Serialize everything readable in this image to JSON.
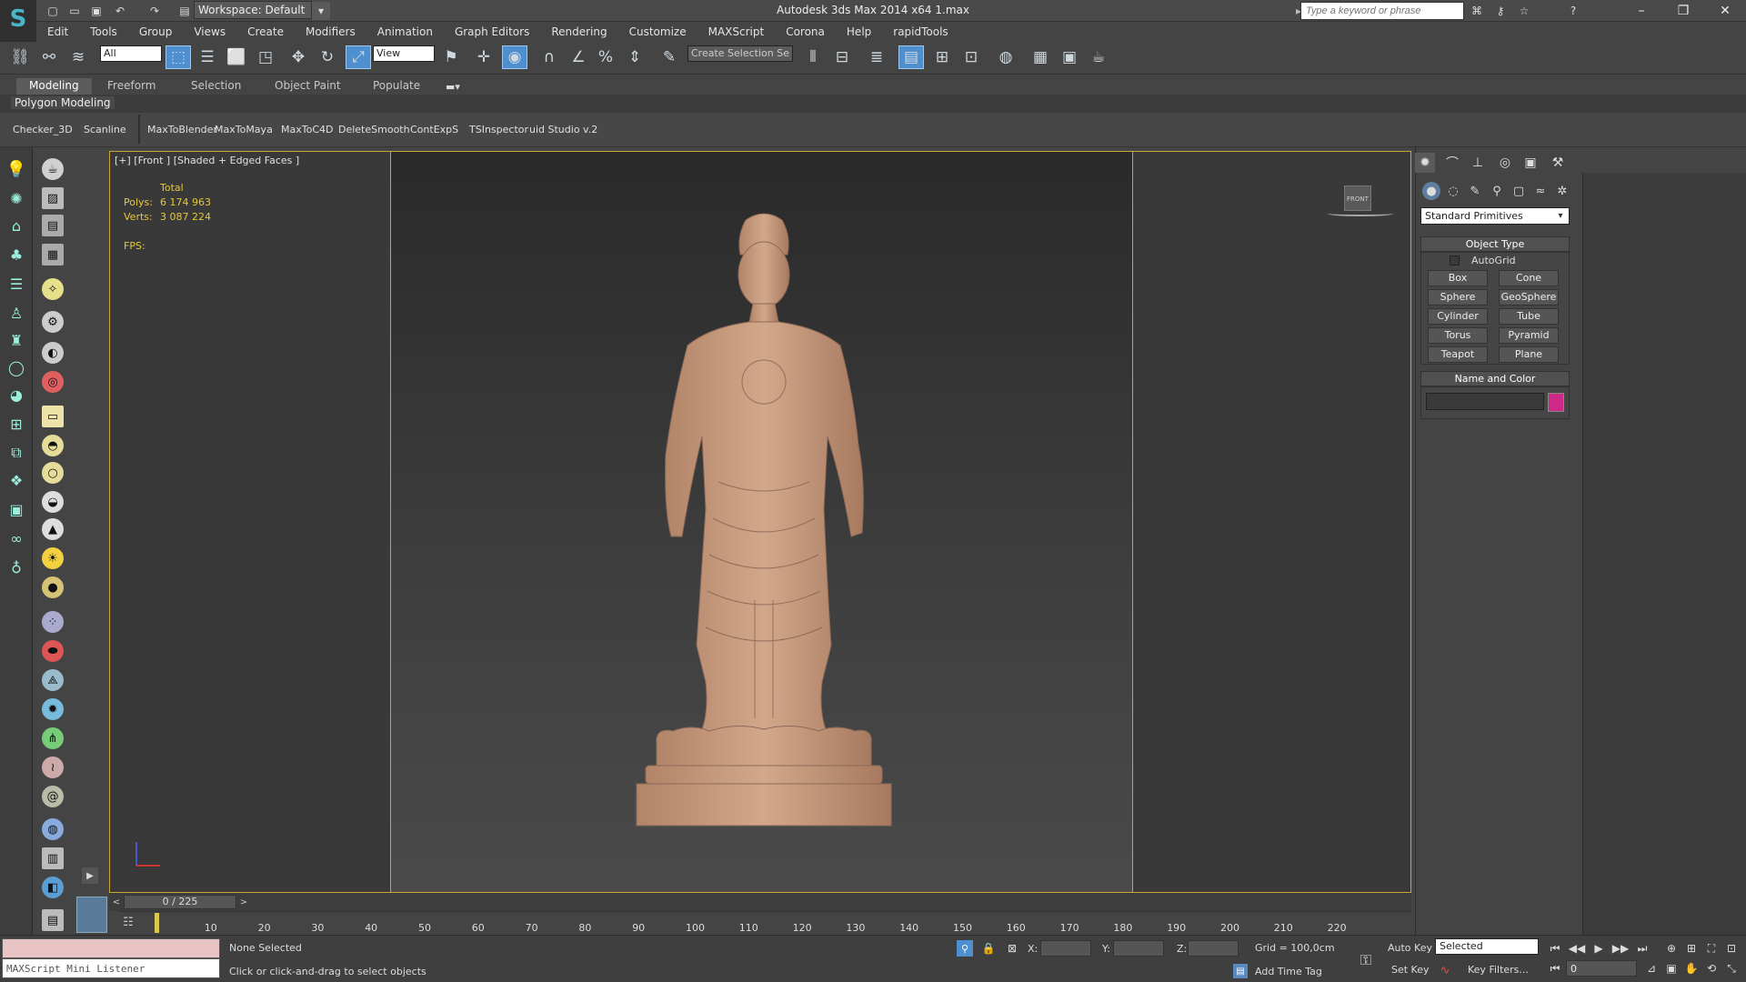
{
  "window": {
    "title": "Autodesk 3ds Max  2014 x64     1.max",
    "workspace": "Workspace: Default",
    "search_placeholder": "Type a keyword or phrase"
  },
  "menu": [
    "Edit",
    "Tools",
    "Group",
    "Views",
    "Create",
    "Modifiers",
    "Animation",
    "Graph Editors",
    "Rendering",
    "Customize",
    "MAXScript",
    "Corona",
    "Help",
    "rapidTools"
  ],
  "toolbar": {
    "filter": "All",
    "ref_coord": "View",
    "named_selection": "Create Selection Se"
  },
  "ribbon": {
    "tabs": [
      "Modeling",
      "Freeform",
      "Selection",
      "Object Paint",
      "Populate"
    ],
    "active": "Modeling",
    "panel": "Polygon Modeling"
  },
  "scripts": [
    "Checker_3D",
    "Scanline",
    "MaxToBlender",
    "MaxToMaya",
    "MaxToC4D",
    "DeleteSmooth",
    "ContExpS",
    "TSInspector",
    "uid Studio v.2"
  ],
  "viewport": {
    "label": "[+] [Front ] [Shaded + Edged Faces ]",
    "stats_header": "Total",
    "polys_label": "Polys:",
    "polys": "6 174 963",
    "verts_label": "Verts:",
    "verts": "3 087 224",
    "fps_label": "FPS:",
    "viewcube": "FRONT"
  },
  "command_panel": {
    "primitive_type": "Standard Primitives",
    "object_type_title": "Object Type",
    "autogrid": "AutoGrid",
    "buttons": [
      "Box",
      "Cone",
      "Sphere",
      "GeoSphere",
      "Cylinder",
      "Tube",
      "Torus",
      "Pyramid",
      "Teapot",
      "Plane"
    ],
    "name_color_title": "Name and Color",
    "object_color": "#cc2a86"
  },
  "timeline": {
    "frame_display": "0 / 225",
    "ticks": [
      "10",
      "20",
      "30",
      "40",
      "50",
      "60",
      "70",
      "80",
      "90",
      "100",
      "110",
      "120",
      "130",
      "140",
      "150",
      "160",
      "170",
      "180",
      "190",
      "200",
      "210",
      "220"
    ]
  },
  "status": {
    "listener": "MAXScript Mini Listener",
    "selection": "None Selected",
    "prompt": "Click or click-and-drag to select objects",
    "x_label": "X:",
    "y_label": "Y:",
    "z_label": "Z:",
    "grid": "Grid = 100,0cm",
    "add_time_tag": "Add Time Tag",
    "auto_key": "Auto Key",
    "set_key": "Set Key",
    "selected": "Selected",
    "key_filters": "Key Filters...",
    "frame": "0"
  },
  "colors": {
    "viewport_frame": "#c8a830",
    "stats": "#e6c83a",
    "statue": "#c9987a"
  }
}
